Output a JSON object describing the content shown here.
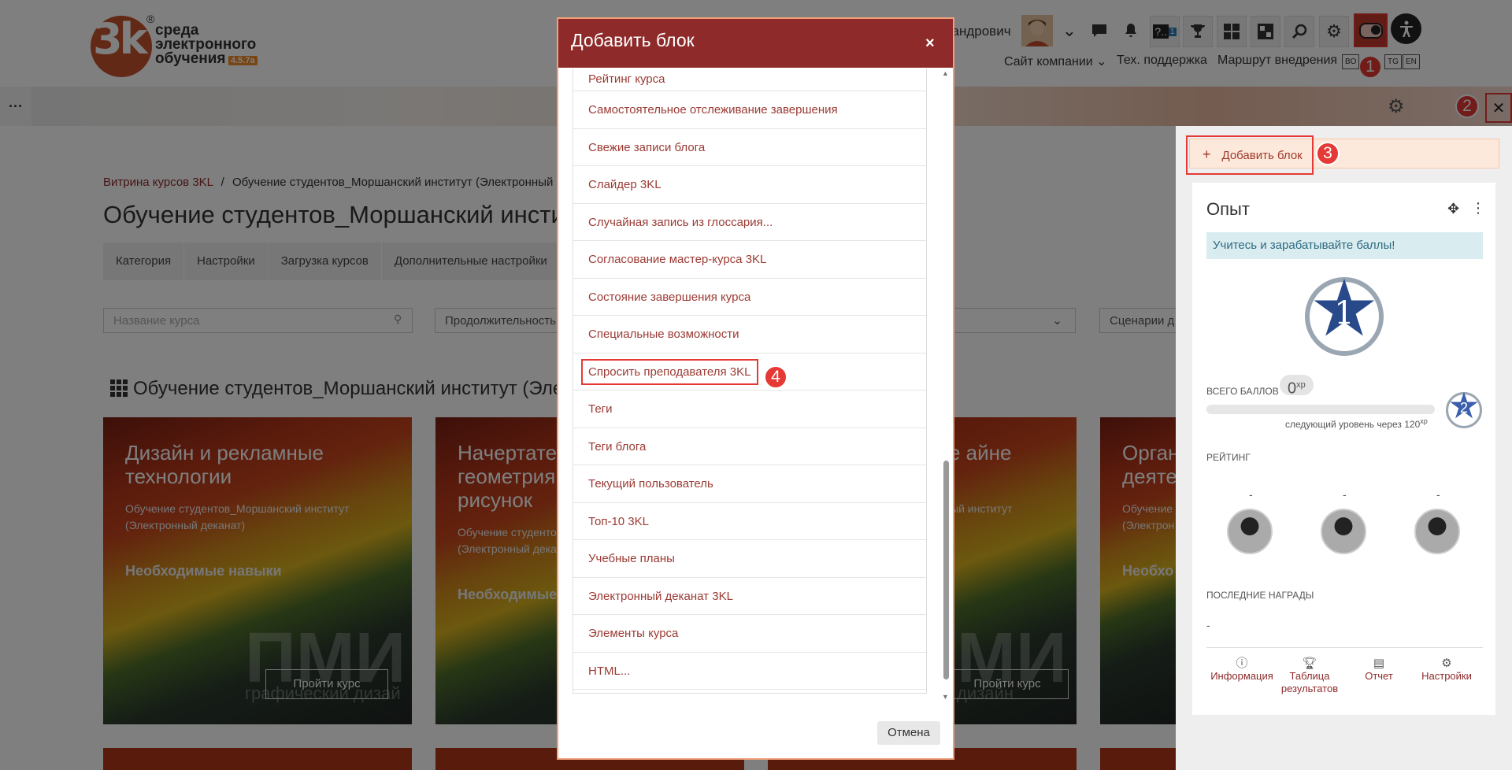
{
  "header": {
    "logo": {
      "mark": "3k",
      "line1": "среда",
      "line2": "электронного",
      "line3": "обучения",
      "version": "4.5.7a",
      "registered": "®"
    },
    "user_name": "сандрович",
    "notification_badge": "1",
    "nav_links": [
      "Сайт компании ⌄",
      "Тех. поддержка",
      "Маршрут внедрения"
    ],
    "langs": [
      "BO",
      "TG",
      "EN"
    ]
  },
  "markers": [
    "1",
    "2",
    "3",
    "4"
  ],
  "banner": {
    "dots": "···"
  },
  "page": {
    "breadcrumb": {
      "root": "Витрина курсов 3KL",
      "sep": "/",
      "current": "Обучение студентов_Моршанский институт (Электронный"
    },
    "title": "Обучение студентов_Моршанский инсти",
    "tabs": [
      "Категория",
      "Настройки",
      "Загрузка курсов",
      "Дополнительные настройки"
    ],
    "search_placeholder": "Название курса",
    "filter1": "Продолжительность",
    "filter3": "Сценарии д",
    "section_title": "Обучение студентов_Моршанский институт (Эле"
  },
  "cards": [
    {
      "title": "Дизайн и рекламные технологии",
      "subtitle": "Обучение студентов_Моршанский институт (Электронный деканат)",
      "skill": "Необходимые навыки",
      "watermark": "ПМИ",
      "button": "Пройти курс",
      "wm_sub": "графический дизай"
    },
    {
      "title": "Начертате геометрия рисунок",
      "subtitle": "Обучение студенто (Электронный дека",
      "skill": "Необходимые"
    },
    {
      "title": "е айне",
      "subtitle": "ый институт",
      "watermark": "МИ",
      "button": "Пройти курс",
      "wm_sub": "дизайн"
    },
    {
      "title": "Орган деяте",
      "subtitle": "Обучение (Электрон",
      "skill": "Необхо"
    }
  ],
  "modal": {
    "title": "Добавить блок",
    "close": "×",
    "items": [
      "Рейтинг курса",
      "Самостоятельное отслеживание завершения",
      "Свежие записи блога",
      "Слайдер 3KL",
      "Случайная запись из глоссария...",
      "Согласование мастер-курса 3KL",
      "Состояние завершения курса",
      "Специальные возможности",
      "Спросить преподавателя 3KL",
      "Теги",
      "Теги блога",
      "Текущий пользователь",
      "Топ-10 3KL",
      "Учебные планы",
      "Электронный деканат 3KL",
      "Элементы курса",
      "HTML..."
    ],
    "cancel": "Отмена"
  },
  "drawer": {
    "add_block": "Добавить блок",
    "add_plus": "+",
    "xp": {
      "title": "Опыт",
      "alert": "Учитесь и зарабатывайте баллы!",
      "level": "1",
      "total_label": "ВСЕГО БАЛЛОВ",
      "total_value": "0",
      "xp_unit": "xp",
      "progress": 0,
      "next_level_text": "следующий уровень через",
      "next_level_value": "120",
      "next_level": "2",
      "rating_label": "РЕЙТИНГ",
      "rank_dash": "-",
      "awards_label": "ПОСЛЕДНИЕ НАГРАДЫ",
      "awards_value": "-",
      "footer": [
        "Информация",
        "Таблица результатов",
        "Отчет",
        "Настройки"
      ]
    }
  },
  "colors": {
    "brand": "#8e2a2a",
    "accent_red": "#e53935",
    "link": "#9b3a33"
  }
}
